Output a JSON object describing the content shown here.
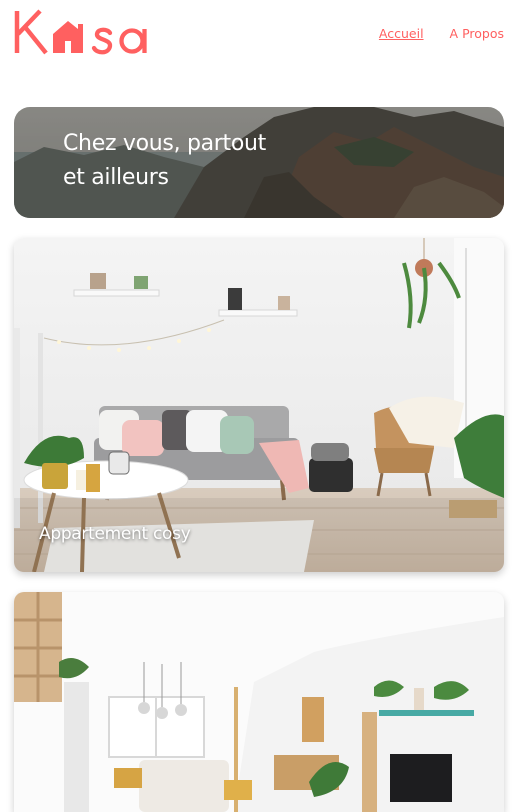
{
  "header": {
    "logo_text": "Kasa",
    "nav": [
      {
        "label": "Accueil",
        "active": true
      },
      {
        "label": "A Propos",
        "active": false
      }
    ]
  },
  "banner": {
    "title_line1": "Chez vous, partout",
    "title_line2": "et ailleurs"
  },
  "listings": [
    {
      "title": "Appartement cosy"
    },
    {
      "title": ""
    }
  ],
  "colors": {
    "accent": "#FF6060",
    "text_on_image": "#FFFFFF"
  }
}
